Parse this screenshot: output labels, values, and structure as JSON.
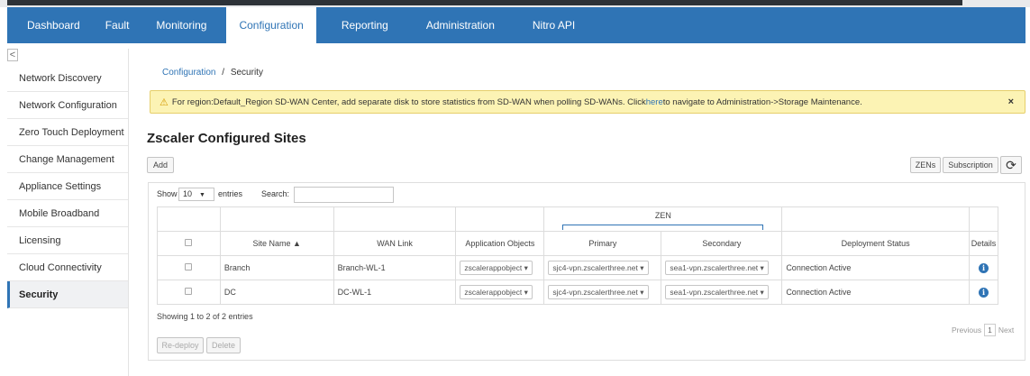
{
  "nav": {
    "tabs": [
      {
        "label": "Dashboard"
      },
      {
        "label": "Fault"
      },
      {
        "label": "Monitoring"
      },
      {
        "label": "Configuration"
      },
      {
        "label": "Reporting"
      },
      {
        "label": "Administration"
      },
      {
        "label": "Nitro API"
      }
    ],
    "active": "Configuration",
    "color": "#2f74b5"
  },
  "sidebar": {
    "collapse_glyph": "<",
    "items": [
      {
        "label": "Network Discovery"
      },
      {
        "label": "Network Configuration"
      },
      {
        "label": "Zero Touch Deployment"
      },
      {
        "label": "Change Management"
      },
      {
        "label": "Appliance Settings"
      },
      {
        "label": "Mobile Broadband"
      },
      {
        "label": "Licensing"
      },
      {
        "label": "Cloud Connectivity"
      },
      {
        "label": "Security"
      }
    ],
    "active": "Security"
  },
  "breadcrumb": {
    "parent": "Configuration",
    "sep": "/",
    "current": "Security"
  },
  "banner": {
    "text_before": "For region:Default_Region SD-WAN Center, add separate disk to store statistics from SD-WAN when polling SD-WANs. Click ",
    "link": "here",
    "text_after": " to navigate to Administration->Storage Maintenance.",
    "close": "×"
  },
  "page": {
    "title": "Zscaler Configured Sites"
  },
  "toolbar": {
    "add": "Add",
    "zens": "ZENs",
    "subscription": "Subscription",
    "refresh_icon": "refresh-icon"
  },
  "table_controls": {
    "show": "Show",
    "page_size": "10",
    "entries": "entries",
    "search_label": "Search:"
  },
  "table": {
    "group_header": "ZEN",
    "columns": [
      "Site Name ▲",
      "WAN Link",
      "Application Objects",
      "Primary",
      "Secondary",
      "Deployment Status",
      "Details"
    ],
    "rows": [
      {
        "site": "Branch",
        "wan": "Branch-WL-1",
        "app": "zscalerappobject",
        "primary": "sjc4-vpn.zscalerthree.net",
        "secondary": "sea1-vpn.zscalerthree.net",
        "status": "Connection Active"
      },
      {
        "site": "DC",
        "wan": "DC-WL-1",
        "app": "zscalerappobject",
        "primary": "sjc4-vpn.zscalerthree.net",
        "secondary": "sea1-vpn.zscalerthree.net",
        "status": "Connection Active"
      }
    ]
  },
  "footer": {
    "showing": "Showing 1 to 2 of 2 entries",
    "previous": "Previous",
    "page": "1",
    "next": "Next",
    "redeploy": "Re-deploy",
    "delete": "Delete"
  }
}
